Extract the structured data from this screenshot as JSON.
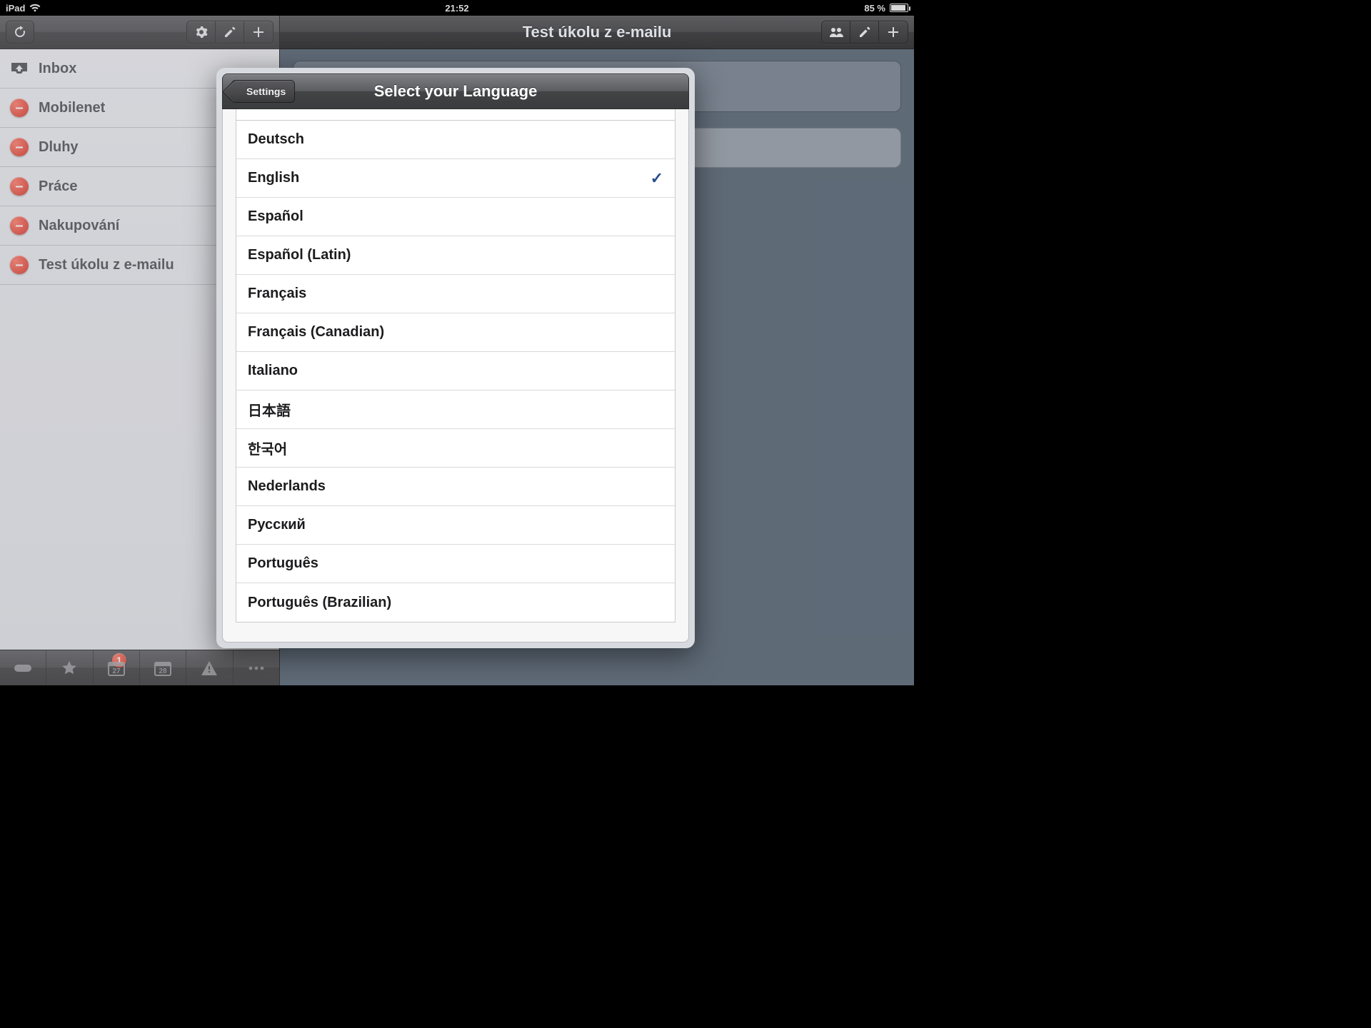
{
  "statusbar": {
    "device": "iPad",
    "time": "21:52",
    "battery": "85 %"
  },
  "sidebar": {
    "toolbar": {},
    "items": [
      {
        "label": "Inbox",
        "kind": "inbox"
      },
      {
        "label": "Mobilenet",
        "kind": "list"
      },
      {
        "label": "Dluhy",
        "kind": "list"
      },
      {
        "label": "Práce",
        "kind": "list"
      },
      {
        "label": "Nakupování",
        "kind": "list"
      },
      {
        "label": "Test úkolu z e-mailu",
        "kind": "list"
      }
    ],
    "badge": "1"
  },
  "detail": {
    "title": "Test úkolu z e-mailu"
  },
  "popover": {
    "back_label": "Settings",
    "title": "Select your Language",
    "selected_index": 1,
    "languages": [
      "Deutsch",
      "English",
      "Español",
      "Español (Latin)",
      "Français",
      "Français (Canadian)",
      "Italiano",
      "日本語",
      "한국어",
      "Nederlands",
      "Русский",
      "Português",
      "Português (Brazilian)"
    ]
  }
}
